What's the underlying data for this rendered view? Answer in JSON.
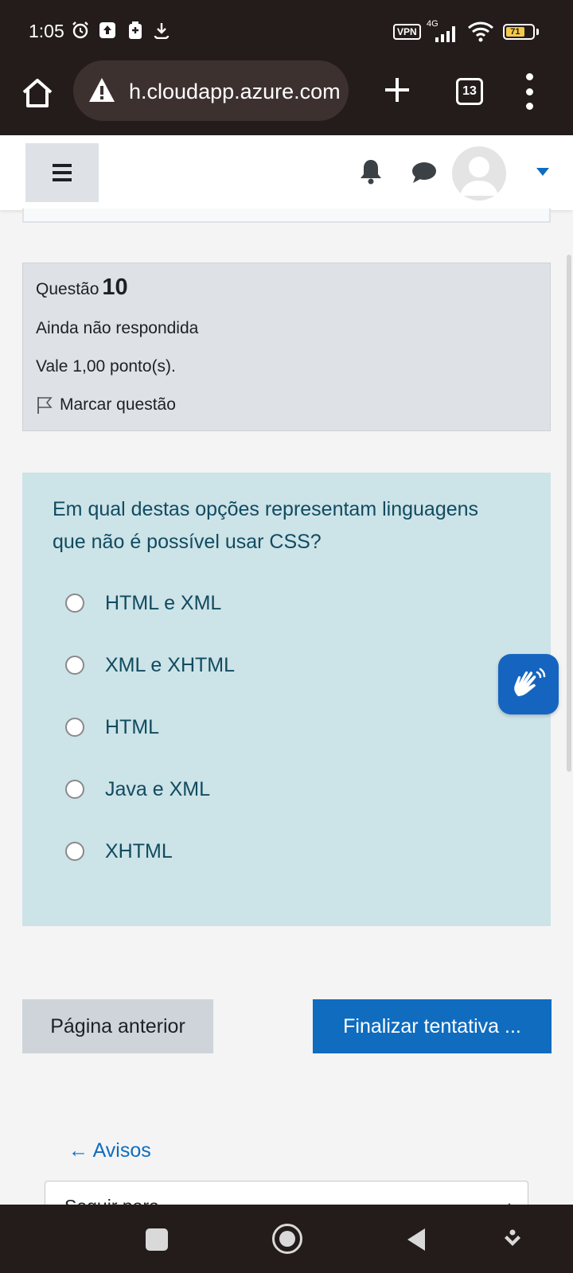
{
  "status_bar": {
    "time": "1:05",
    "vpn": "VPN",
    "network": "4G",
    "battery": "71",
    "battery_level": 0.71
  },
  "browser": {
    "url": "h.cloudapp.azure.com",
    "tab_count": "13"
  },
  "question": {
    "label": "Questão",
    "number": "10",
    "state": "Ainda não respondida",
    "grade": "Vale 1,00 ponto(s).",
    "flag_label": "Marcar questão",
    "text": "Em qual destas opções  representam linguagens que não é possível usar CSS?",
    "options": [
      {
        "label": "HTML e XML"
      },
      {
        "label": "XML e XHTML"
      },
      {
        "label": "HTML"
      },
      {
        "label": "Java e XML"
      },
      {
        "label": "XHTML"
      }
    ]
  },
  "navigation": {
    "prev_label": "Página anterior",
    "finish_label": "Finalizar tentativa ...",
    "back_link": "← Avisos",
    "jump_label": "Seguir para..."
  },
  "colors": {
    "primary": "#0f6cbf",
    "question_bg": "#cce3e8",
    "info_bg": "#dee2e6",
    "system_bar": "#241c1b"
  },
  "icons": [
    "alarm-icon",
    "upload-icon",
    "battery-saver-icon",
    "download-icon",
    "signal-icon",
    "wifi-icon",
    "home-icon",
    "warning-icon",
    "plus-icon",
    "menu-icon",
    "bell-icon",
    "chat-icon",
    "avatar",
    "caret-down-icon",
    "flag-icon",
    "sign-language-icon"
  ]
}
